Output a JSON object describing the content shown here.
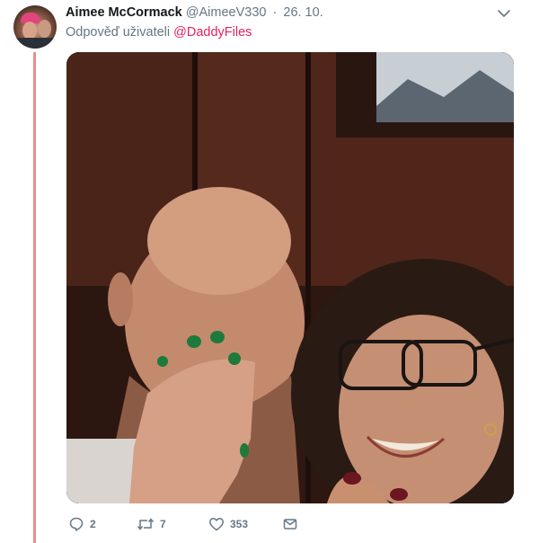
{
  "tweet": {
    "author_name": "Aimee McCormack",
    "author_handle": "@AimeeV330",
    "separator": "·",
    "date": "26. 10.",
    "reply_prefix": "Odpověď uživateli",
    "reply_mention": "@DaddyFiles",
    "actions": {
      "reply_count": "2",
      "retweet_count": "7",
      "like_count": "353"
    }
  },
  "icons": {
    "chevron": "chevron-down-icon",
    "reply": "reply-bubble-icon",
    "retweet": "retweet-icon",
    "like": "heart-icon",
    "message": "envelope-icon"
  },
  "colors": {
    "thread_line": "#ec8c8c",
    "mention": "#e0245e",
    "muted": "#657786",
    "text": "#14171a"
  }
}
